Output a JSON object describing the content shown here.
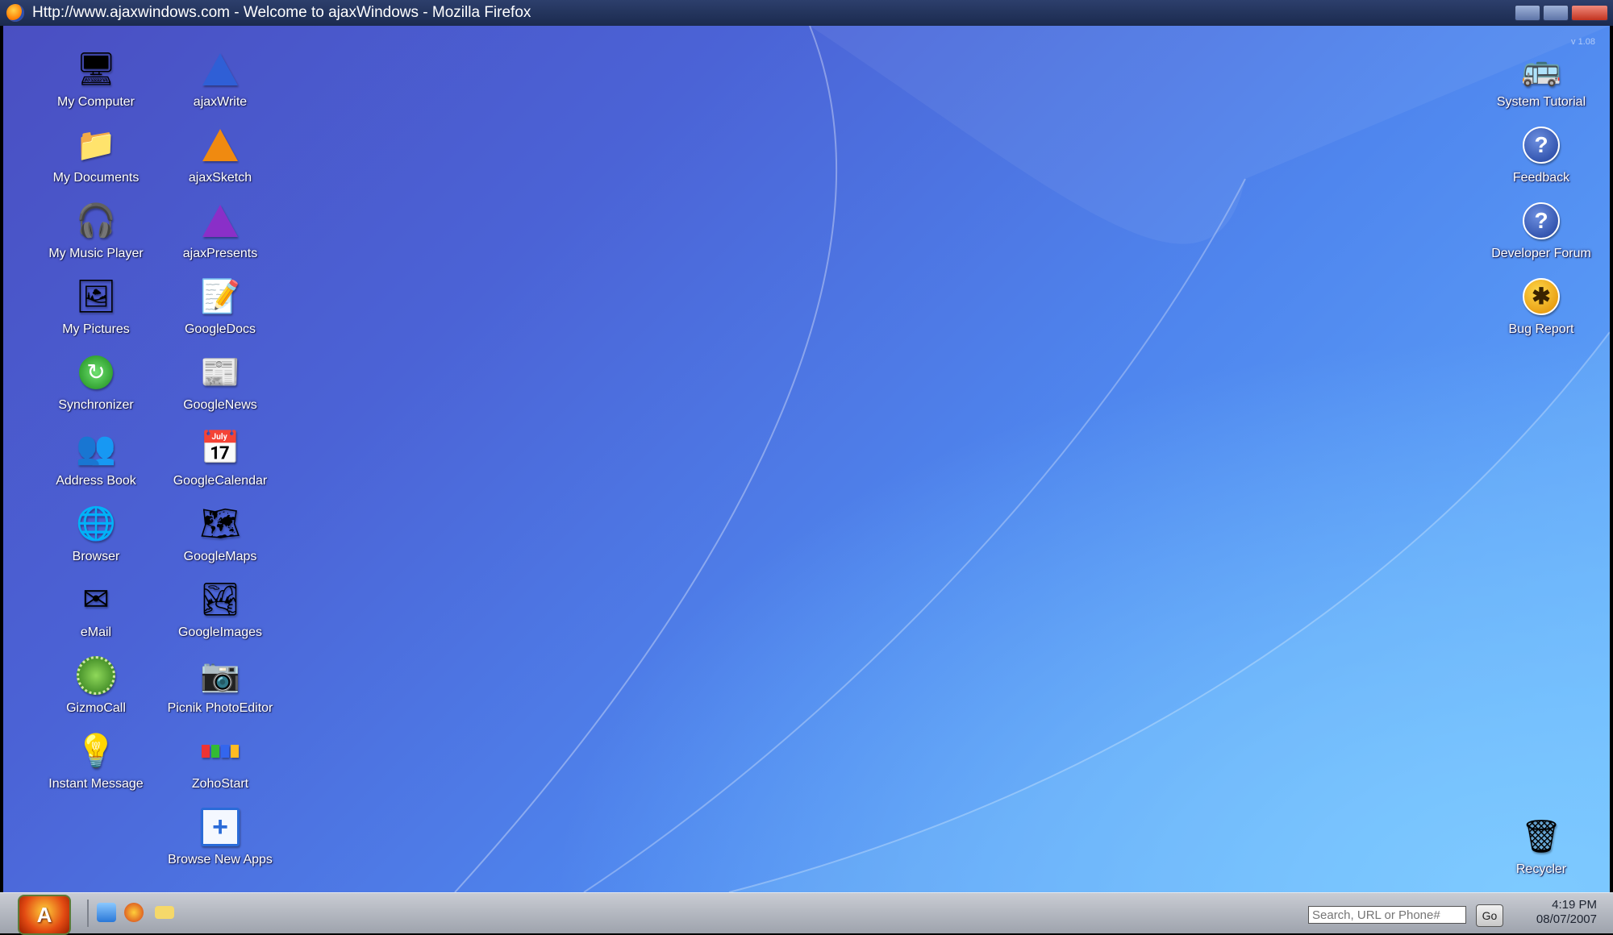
{
  "window": {
    "title": "Http://www.ajaxwindows.com - Welcome to ajaxWindows - Mozilla Firefox"
  },
  "desktop": {
    "version": "v 1.08",
    "left_icons": [
      {
        "label": "My Computer",
        "icon": "computer-icon"
      },
      {
        "label": "My Documents",
        "icon": "folder-icon"
      },
      {
        "label": "My Music Player",
        "icon": "headphones-icon"
      },
      {
        "label": "My Pictures",
        "icon": "picture-icon"
      },
      {
        "label": "Synchronizer",
        "icon": "sync-icon"
      },
      {
        "label": "Address Book",
        "icon": "people-icon"
      },
      {
        "label": "Browser",
        "icon": "globe-icon"
      },
      {
        "label": "eMail",
        "icon": "envelope-icon"
      },
      {
        "label": "GizmoCall",
        "icon": "gizmo-icon"
      },
      {
        "label": "Instant Message",
        "icon": "chat-bulb-icon"
      }
    ],
    "mid_icons": [
      {
        "label": "ajaxWrite",
        "icon": "write-icon"
      },
      {
        "label": "ajaxSketch",
        "icon": "sketch-icon"
      },
      {
        "label": "ajaxPresents",
        "icon": "presents-icon"
      },
      {
        "label": "GoogleDocs",
        "icon": "docs-icon"
      },
      {
        "label": "GoogleNews",
        "icon": "news-icon"
      },
      {
        "label": "GoogleCalendar",
        "icon": "calendar-icon"
      },
      {
        "label": "GoogleMaps",
        "icon": "map-icon"
      },
      {
        "label": "GoogleImages",
        "icon": "images-icon"
      },
      {
        "label": "Picnik PhotoEditor",
        "icon": "camera-icon"
      },
      {
        "label": "ZohoStart",
        "icon": "zoho-icon"
      },
      {
        "label": "Browse New Apps",
        "icon": "add-app-icon"
      }
    ],
    "right_icons": [
      {
        "label": "System Tutorial",
        "icon": "school-bus-icon"
      },
      {
        "label": "Feedback",
        "icon": "help-icon"
      },
      {
        "label": "Developer Forum",
        "icon": "help-icon"
      },
      {
        "label": "Bug Report",
        "icon": "bug-icon"
      }
    ],
    "recycler": {
      "label": "Recycler",
      "icon": "trash-icon"
    }
  },
  "taskbar": {
    "start_label": "A",
    "search_placeholder": "Search, URL or Phone#",
    "go_label": "Go",
    "time": "4:19 PM",
    "date": "08/07/2007"
  },
  "colors": {
    "desktop_top": "#4a4fc2",
    "desktop_bottom": "#63b0ff",
    "taskbar": "#b8bcc4"
  }
}
